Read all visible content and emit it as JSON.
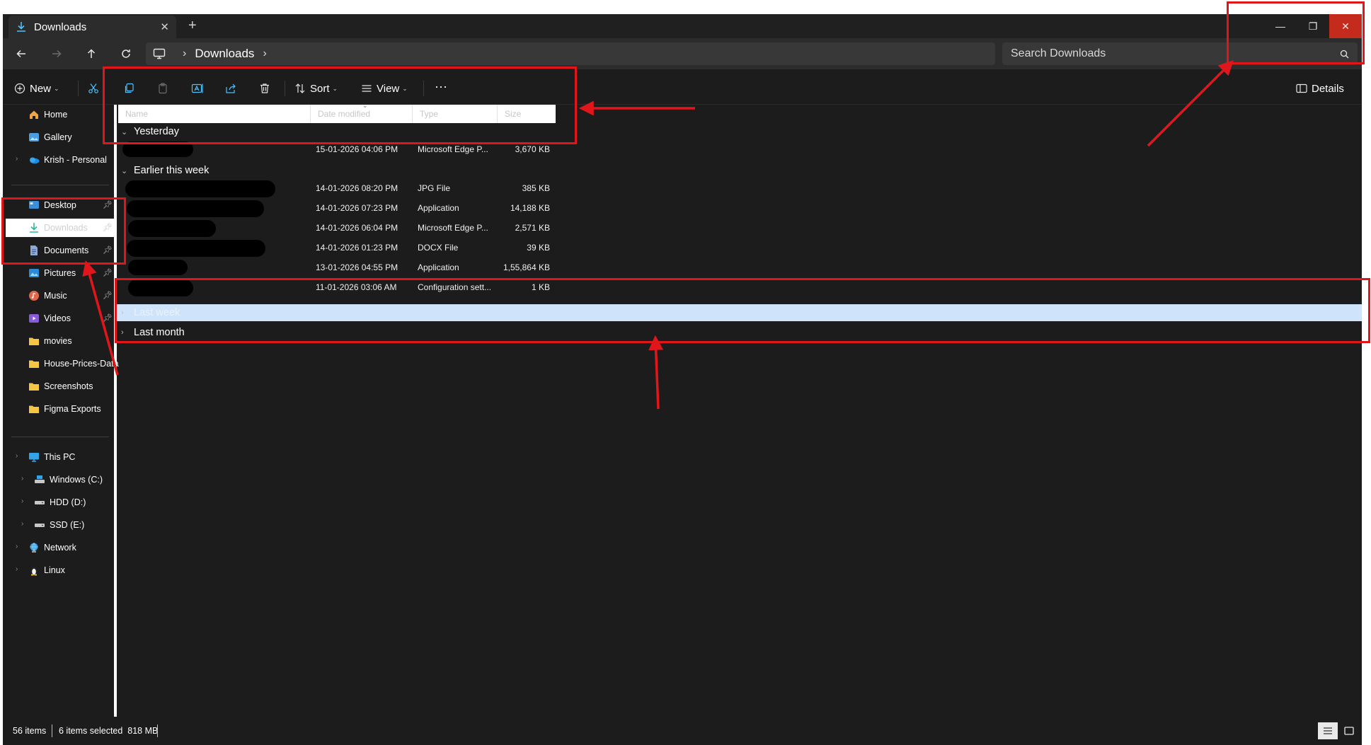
{
  "tab": {
    "title": "Downloads",
    "close_glyph": "✕",
    "new_tab_glyph": "+"
  },
  "window_controls": {
    "minimize_glyph": "—",
    "restore_glyph": "❐",
    "close_glyph": "✕"
  },
  "address": {
    "location": "Downloads",
    "search_placeholder": "Search Downloads"
  },
  "toolbar": {
    "new_label": "New",
    "sort_label": "Sort",
    "view_label": "View",
    "more_glyph": "···",
    "details_label": "Details"
  },
  "sidebar": {
    "quick": [
      {
        "label": "Home",
        "icon": "home-icon"
      },
      {
        "label": "Gallery",
        "icon": "gallery-icon"
      },
      {
        "label": "Krish - Personal",
        "icon": "onedrive-icon"
      }
    ],
    "pinned": [
      {
        "label": "Desktop",
        "icon": "desktop-icon",
        "pinned": true
      },
      {
        "label": "Downloads",
        "icon": "download-icon",
        "pinned": true,
        "selected": true
      },
      {
        "label": "Documents",
        "icon": "documents-icon",
        "pinned": true
      },
      {
        "label": "Pictures",
        "icon": "pictures-icon",
        "pinned": true
      },
      {
        "label": "Music",
        "icon": "music-icon",
        "pinned": true
      },
      {
        "label": "Videos",
        "icon": "videos-icon",
        "pinned": true
      },
      {
        "label": "movies",
        "icon": "folder-icon"
      },
      {
        "label": "House-Prices-Data",
        "icon": "folder-icon"
      },
      {
        "label": "Screenshots",
        "icon": "folder-icon"
      },
      {
        "label": "Figma Exports",
        "icon": "folder-icon"
      }
    ],
    "devices": [
      {
        "label": "This PC",
        "icon": "pc-icon"
      },
      {
        "label": "Windows (C:)",
        "icon": "drive-c-icon"
      },
      {
        "label": "HDD (D:)",
        "icon": "drive-icon"
      },
      {
        "label": "SSD (E:)",
        "icon": "drive-icon"
      },
      {
        "label": "Network",
        "icon": "network-icon"
      },
      {
        "label": "Linux",
        "icon": "linux-icon"
      }
    ]
  },
  "columns": [
    "Name",
    "Date modified",
    "Type",
    "Size"
  ],
  "groups": [
    {
      "label": "Yesterday",
      "expanded": true,
      "rows": [
        {
          "date": "15-01-2026 04:06 PM",
          "type": "Microsoft Edge P...",
          "size": "3,670 KB"
        }
      ]
    },
    {
      "label": "Earlier this week",
      "expanded": true,
      "rows": [
        {
          "date": "14-01-2026 08:20 PM",
          "type": "JPG File",
          "size": "385 KB"
        },
        {
          "date": "14-01-2026 07:23 PM",
          "type": "Application",
          "size": "14,188 KB"
        },
        {
          "date": "14-01-2026 06:04 PM",
          "type": "Microsoft Edge P...",
          "size": "2,571 KB"
        },
        {
          "date": "14-01-2026 01:23 PM",
          "type": "DOCX File",
          "size": "39 KB"
        },
        {
          "date": "13-01-2026 04:55 PM",
          "type": "Application",
          "size": "1,55,864 KB"
        },
        {
          "date": "11-01-2026 03:06 AM",
          "type": "Configuration sett...",
          "size": "1 KB"
        }
      ]
    },
    {
      "label": "Last week",
      "expanded": false,
      "highlighted": true,
      "rows": []
    },
    {
      "label": "Last month",
      "expanded": false,
      "rows": []
    }
  ],
  "status": {
    "item_count": "56 items",
    "selection": "6 items selected  818 MB"
  },
  "colors": {
    "annotation": "#e0161b",
    "accent": "#4cc2ff",
    "highlight_row": "#cfe4fb"
  }
}
